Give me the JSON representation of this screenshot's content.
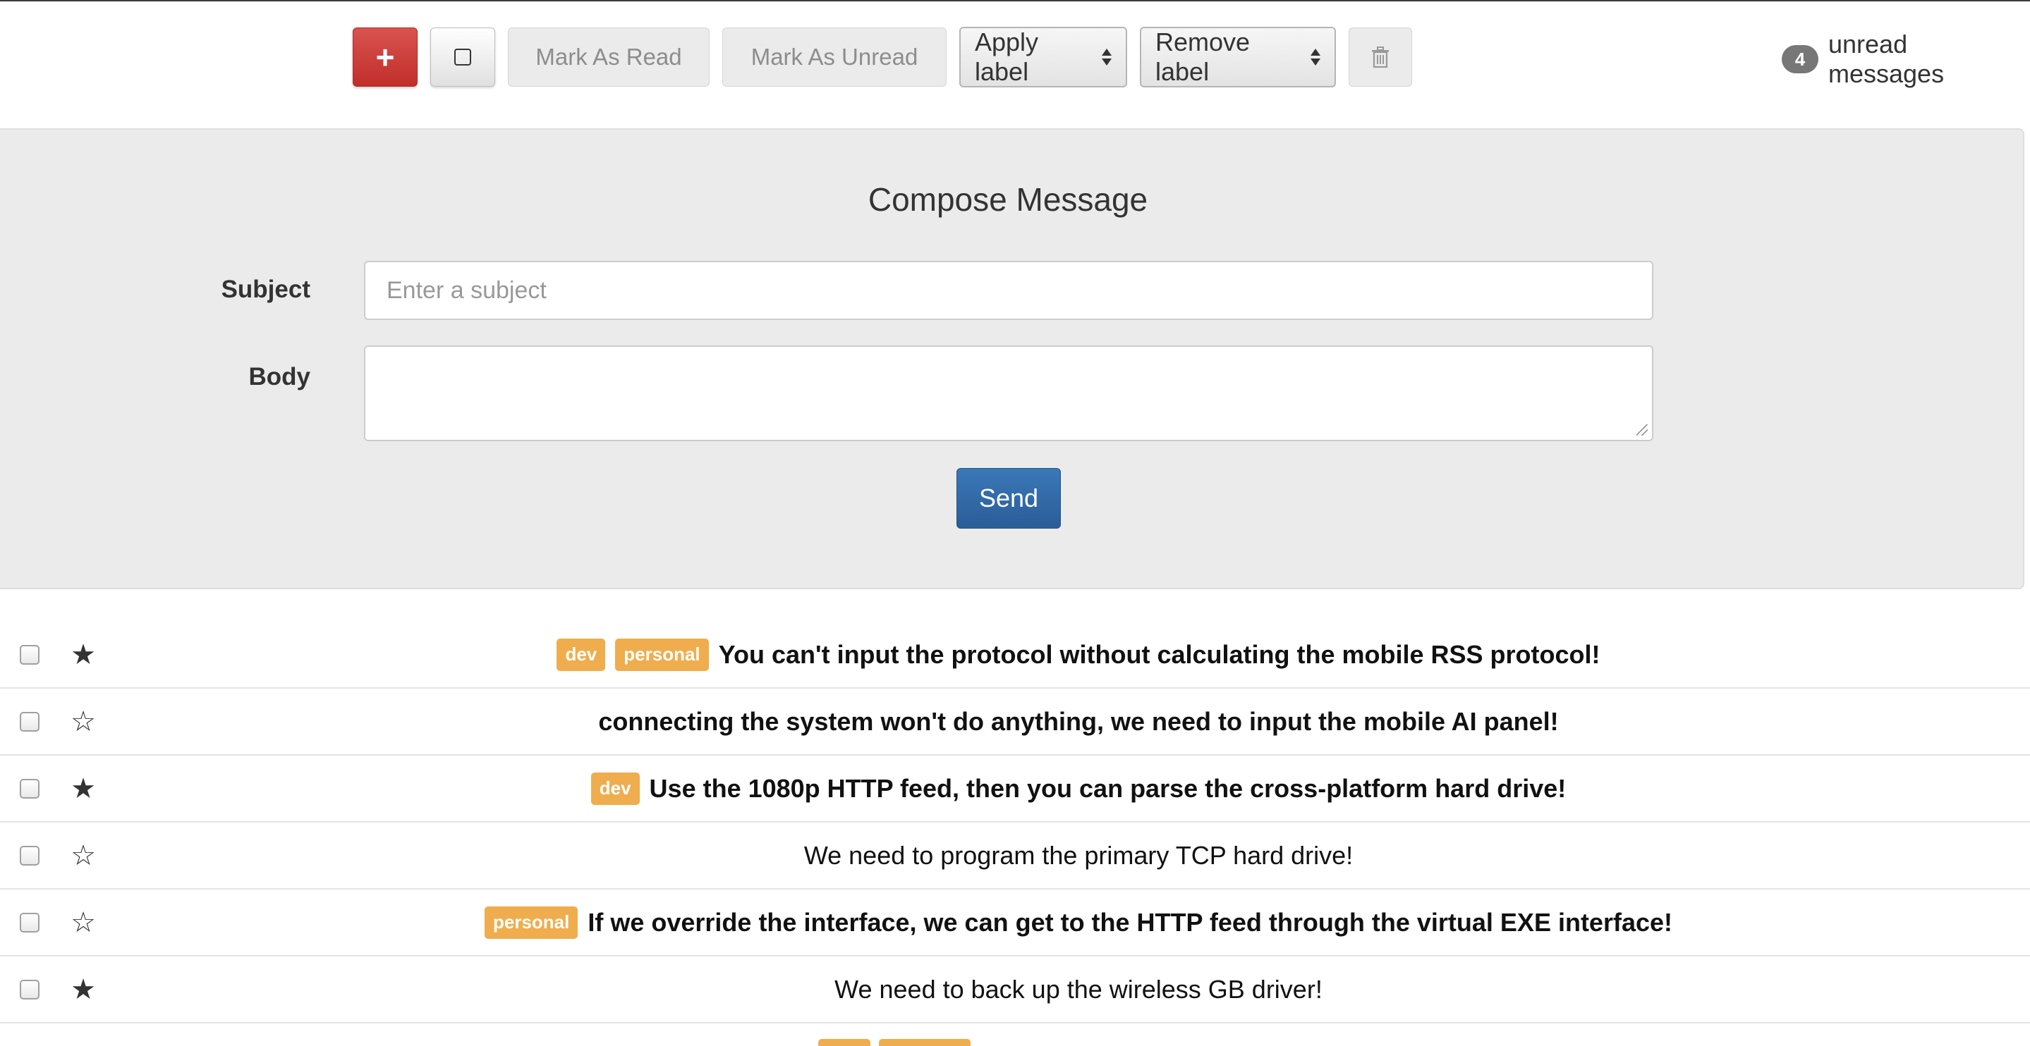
{
  "toolbar": {
    "compose_label": "+",
    "mark_read_label": "Mark As Read",
    "mark_unread_label": "Mark As Unread",
    "apply_label": "Apply label",
    "remove_label": "Remove label",
    "icons": {
      "compose": "plus-icon",
      "select": "checkbox-empty-icon",
      "trash": "trash-icon"
    }
  },
  "unread": {
    "count": "4",
    "text": "unread messages"
  },
  "compose": {
    "title": "Compose Message",
    "subject_label": "Subject",
    "subject_placeholder": "Enter a subject",
    "subject_value": "",
    "body_label": "Body",
    "body_value": "",
    "send_label": "Send"
  },
  "messages": [
    {
      "starred": true,
      "read": false,
      "labels": [
        "dev",
        "personal"
      ],
      "subject": "You can't input the protocol without calculating the mobile RSS protocol!"
    },
    {
      "starred": false,
      "read": false,
      "labels": [],
      "subject": "connecting the system won't do anything, we need to input the mobile AI panel!"
    },
    {
      "starred": true,
      "read": false,
      "labels": [
        "dev"
      ],
      "subject": "Use the 1080p HTTP feed, then you can parse the cross-platform hard drive!"
    },
    {
      "starred": false,
      "read": true,
      "labels": [],
      "subject": "We need to program the primary TCP hard drive!"
    },
    {
      "starred": false,
      "read": false,
      "labels": [
        "personal"
      ],
      "subject": "If we override the interface, we can get to the HTTP feed through the virtual EXE interface!"
    },
    {
      "starred": true,
      "read": true,
      "labels": [],
      "subject": "We need to back up the wireless GB driver!"
    }
  ],
  "colors": {
    "danger": "#c9302c",
    "primary": "#2f6aa8",
    "label_warning": "#efad4d",
    "badge": "#777777",
    "panel_bg": "#ebebeb"
  }
}
